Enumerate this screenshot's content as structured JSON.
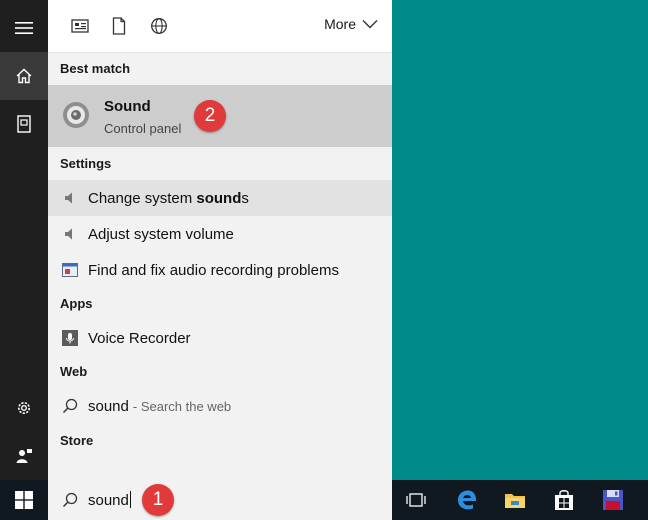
{
  "topbar": {
    "more_label": "More",
    "filter_icons": [
      "apps-filter-icon",
      "documents-filter-icon",
      "web-filter-icon"
    ]
  },
  "sections": {
    "best_match": "Best match",
    "settings": "Settings",
    "apps": "Apps",
    "web": "Web",
    "store": "Store"
  },
  "best_match_item": {
    "title": "Sound",
    "subtitle": "Control panel",
    "icon": "speaker-icon"
  },
  "settings_items": [
    {
      "label": "Change system ",
      "bold": "sound",
      "tail": "s",
      "icon": "speaker-small-icon"
    },
    {
      "label": "Adjust system volume",
      "icon": "speaker-small-icon"
    },
    {
      "label": "Find and fix audio recording problems",
      "icon": "troubleshooter-icon"
    }
  ],
  "apps_items": [
    {
      "label": "Voice Recorder",
      "icon": "microphone-icon"
    }
  ],
  "web_items": [
    {
      "query": "sound",
      "hint": " - Search the web",
      "icon": "search-icon"
    }
  ],
  "search": {
    "value": "sound"
  },
  "annotations": {
    "step1": "1",
    "step2": "2"
  },
  "colors": {
    "desktop": "#008a8a",
    "rail": "#1f1f1f",
    "panel": "#f2f2f2",
    "highlight": "#cdcdcd",
    "badge": "#e03a3a",
    "taskbar": "#101820"
  }
}
